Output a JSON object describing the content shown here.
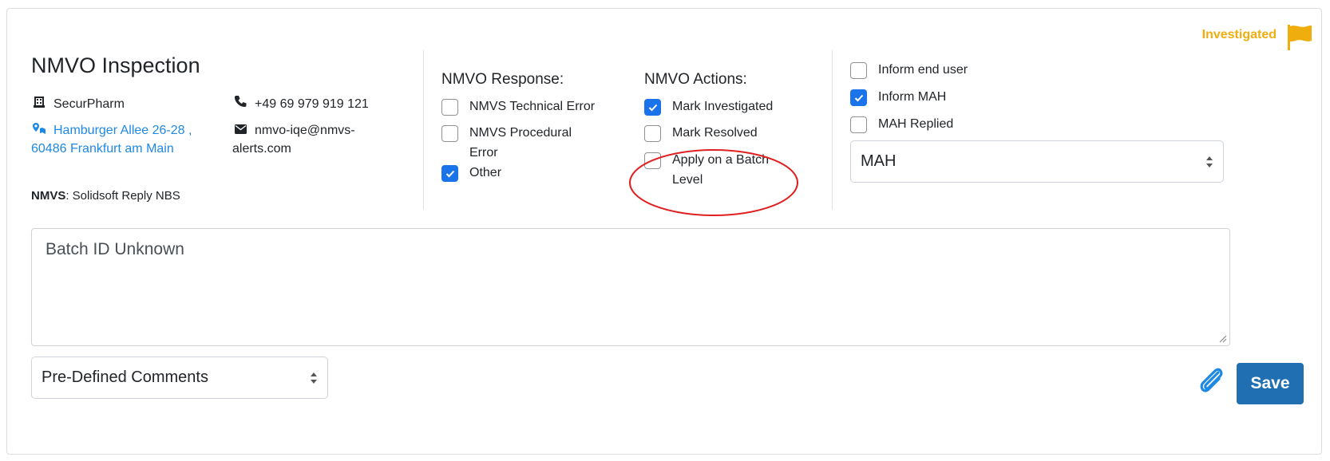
{
  "status": {
    "label": "Investigated",
    "color": "#f0ad0e"
  },
  "inspection": {
    "title": "NMVO Inspection",
    "organization": "SecurPharm",
    "address": "Hamburger Allee 26-28 , 60486 Frankfurt am Main",
    "nmvs_label": "NMVS",
    "nmvs_value": ": Solidsoft Reply NBS",
    "phone": "+49 69 979 919 121",
    "email": "nmvo-iqe@nmvs-alerts.com"
  },
  "response": {
    "title": "NMVO Response:",
    "options": [
      {
        "label": "NMVS Technical Error",
        "checked": false
      },
      {
        "label": "NMVS Procedural Error",
        "checked": false
      },
      {
        "label": "Other",
        "checked": true
      }
    ]
  },
  "actions": {
    "title": "NMVO Actions:",
    "options": [
      {
        "label": "Mark Investigated",
        "checked": true
      },
      {
        "label": "Mark Resolved",
        "checked": false
      },
      {
        "label": "Apply on a Batch Level",
        "checked": false
      }
    ]
  },
  "notifications": {
    "options": [
      {
        "label": "Inform end user",
        "checked": false
      },
      {
        "label": "Inform MAH",
        "checked": true
      },
      {
        "label": "MAH Replied",
        "checked": false
      }
    ],
    "recipient_select": "MAH"
  },
  "comment": {
    "value": "Batch ID Unknown",
    "predefined_select": "Pre-Defined Comments"
  },
  "footer": {
    "save_label": "Save"
  },
  "colors": {
    "accent": "#1a73e8",
    "save": "#1f6fb2",
    "link": "#1e88e5",
    "annotation": "#e02020"
  },
  "icons": [
    "flag-icon",
    "building-icon",
    "map-marker-icon",
    "phone-icon",
    "envelope-icon",
    "paperclip-icon",
    "check-icon",
    "sort-arrows-icon",
    "resize-grip-icon"
  ]
}
